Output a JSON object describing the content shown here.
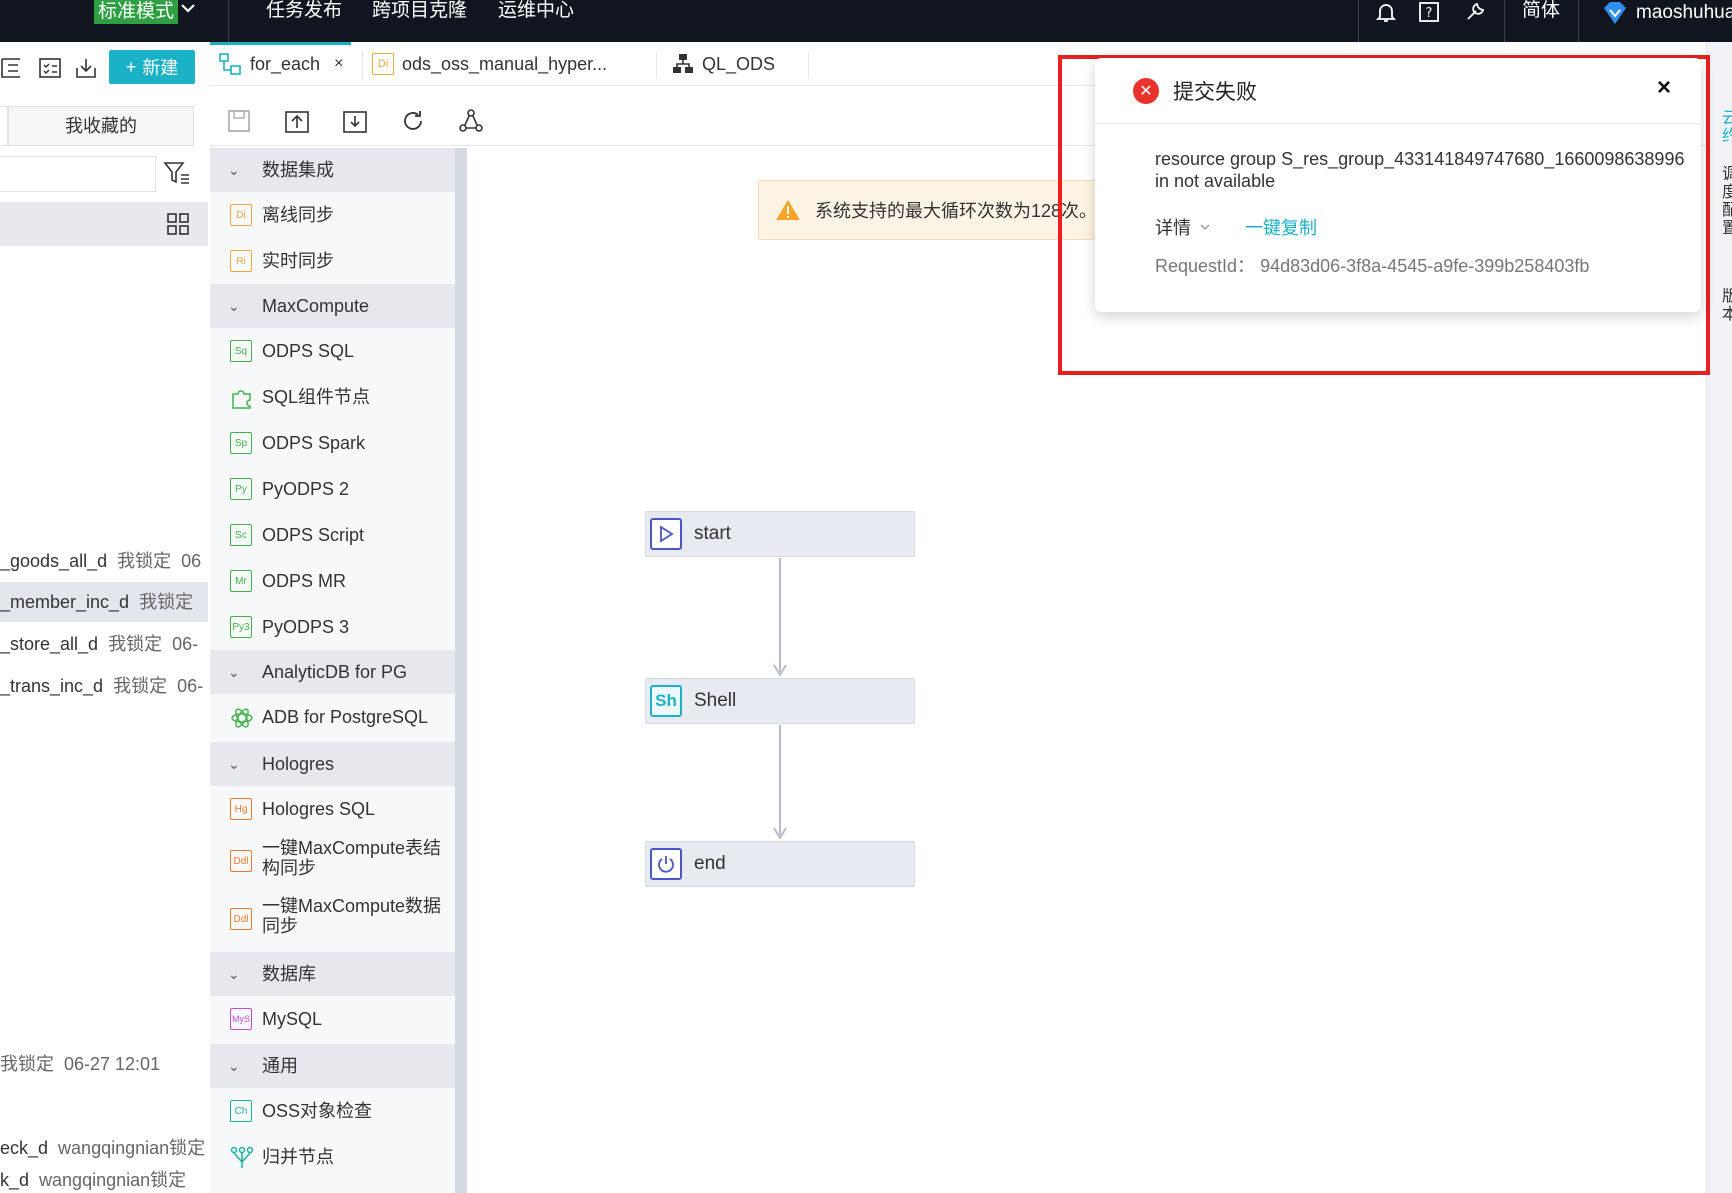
{
  "topbar": {
    "mode": "标准模式",
    "menus": [
      "任务发布",
      "跨项目克隆",
      "运维中心"
    ],
    "language": "简体",
    "username": "maoshuhua"
  },
  "sidebar": {
    "new_button": "新建",
    "favorites_tab": "我收藏的",
    "search_placeholder": "",
    "files": [
      {
        "name": "_goods_all_d",
        "lock": "我锁定",
        "time": "06"
      },
      {
        "name": "_member_inc_d",
        "lock": "我锁定",
        "time": ""
      },
      {
        "name": "_store_all_d",
        "lock": "我锁定",
        "time": "06-"
      },
      {
        "name": "_trans_inc_d",
        "lock": "我锁定",
        "time": "06-"
      },
      {
        "name": "",
        "lock": "我锁定",
        "time": "06-27 12:01"
      },
      {
        "name": "eck_d",
        "lock": "wangqingnian锁定",
        "time": ""
      },
      {
        "name": "k_d",
        "lock": "wangqingnian锁定",
        "time": ""
      }
    ]
  },
  "tabs": [
    {
      "label": "for_each",
      "icon": "flow-icon",
      "close": "×"
    },
    {
      "label": "ods_oss_manual_hyper...",
      "icon": "Di",
      "close": ""
    },
    {
      "label": "QL_ODS",
      "icon": "tree-icon",
      "close": ""
    }
  ],
  "palette": {
    "groups": [
      {
        "label": "数据集成",
        "items": [
          {
            "badge": "Di",
            "label": "离线同步",
            "color": "#f0a73a"
          },
          {
            "badge": "Ri",
            "label": "实时同步",
            "color": "#f0a73a"
          }
        ]
      },
      {
        "label": "MaxCompute",
        "items": [
          {
            "badge": "Sq",
            "label": "ODPS SQL",
            "color": "#3fb24a"
          },
          {
            "badge": "",
            "label": "SQL组件节点",
            "color": "#3fb24a"
          },
          {
            "badge": "Sp",
            "label": "ODPS Spark",
            "color": "#3fb24a"
          },
          {
            "badge": "Py",
            "label": "PyODPS 2",
            "color": "#3fb24a"
          },
          {
            "badge": "Sc",
            "label": "ODPS Script",
            "color": "#3fb24a"
          },
          {
            "badge": "Mr",
            "label": "ODPS MR",
            "color": "#3fb24a"
          },
          {
            "badge": "Py3",
            "label": "PyODPS 3",
            "color": "#3fb24a"
          }
        ]
      },
      {
        "label": "AnalyticDB for PG",
        "items": [
          {
            "badge": "",
            "label": "ADB for PostgreSQL",
            "color": "#3fb24a"
          }
        ]
      },
      {
        "label": "Hologres",
        "items": [
          {
            "badge": "Hg",
            "label": "Hologres SQL",
            "color": "#f07a2a"
          },
          {
            "badge": "Ddl",
            "label": "一键MaxCompute表结构同步",
            "color": "#f07a2a"
          },
          {
            "badge": "Ddl",
            "label": "一键MaxCompute数据同步",
            "color": "#f07a2a"
          }
        ]
      },
      {
        "label": "数据库",
        "items": [
          {
            "badge": "MyS",
            "label": "MySQL",
            "color": "#c64bd1"
          }
        ]
      },
      {
        "label": "通用",
        "items": [
          {
            "badge": "Ch",
            "label": "OSS对象检查",
            "color": "#1bb2a0"
          },
          {
            "badge": "",
            "label": "归并节点",
            "color": "#1bb2a0"
          }
        ]
      }
    ]
  },
  "canvas": {
    "warning": "系统支持的最大循环次数为128次。",
    "nodes": [
      {
        "label": "start",
        "icon": "play-icon"
      },
      {
        "label": "Shell",
        "icon": "Sh"
      },
      {
        "label": "end",
        "icon": "power-icon"
      }
    ]
  },
  "error_popup": {
    "title": "提交失败",
    "close": "×",
    "message": "resource group S_res_group_433141849747680_1660098638996 in not available",
    "detail_label": "详情",
    "copy_label": "一键复制",
    "request_label": "RequestId：",
    "request_id": "94d83d06-3f8a-4545-a9fe-399b258403fb"
  },
  "right_strip": {
    "text1": "云约",
    "text2": "调度配置",
    "text3": "版本"
  },
  "colors": {
    "accent": "#1bb2c8",
    "error": "#e8322b",
    "highlight_box": "#ea1f1f",
    "mode_badge": "#2ea043"
  }
}
